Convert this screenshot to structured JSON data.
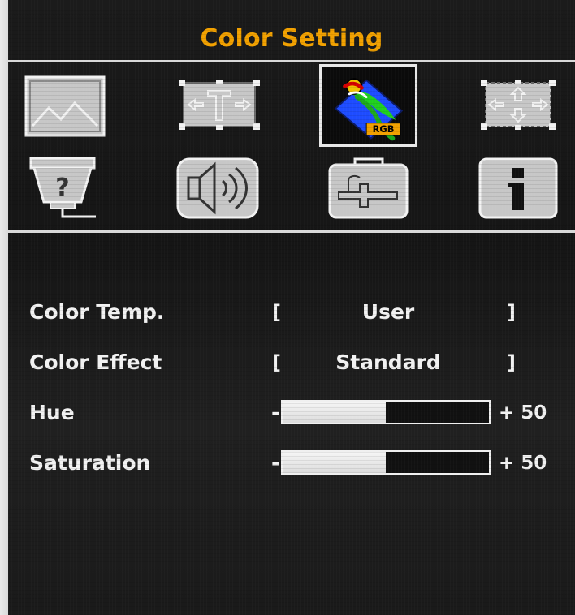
{
  "header": {
    "title": "Color Setting"
  },
  "icons": [
    {
      "name": "picture-icon",
      "selected": false
    },
    {
      "name": "position-icon",
      "selected": false
    },
    {
      "name": "color-rgb-icon",
      "selected": true,
      "label": "RGB"
    },
    {
      "name": "zoom-icon",
      "selected": false
    },
    {
      "name": "input-source-icon",
      "selected": false
    },
    {
      "name": "audio-icon",
      "selected": false
    },
    {
      "name": "setup-icon",
      "selected": false
    },
    {
      "name": "info-icon",
      "selected": false
    }
  ],
  "settings": {
    "color_temp": {
      "label": "Color Temp.",
      "open_bracket": "[",
      "value": "User",
      "close_bracket": "]"
    },
    "color_effect": {
      "label": "Color Effect",
      "open_bracket": "[",
      "value": "Standard",
      "close_bracket": "]"
    },
    "hue": {
      "label": "Hue",
      "minus": "-",
      "plus_value": "+ 50",
      "level_fraction": 0.5
    },
    "saturation": {
      "label": "Saturation",
      "minus": "-",
      "plus_value": "+ 50",
      "level_fraction": 0.5
    }
  },
  "colors": {
    "title": "#f2a100",
    "text": "#f2f2f2",
    "background": "#151515",
    "selected_border": "#e8e8e8"
  }
}
